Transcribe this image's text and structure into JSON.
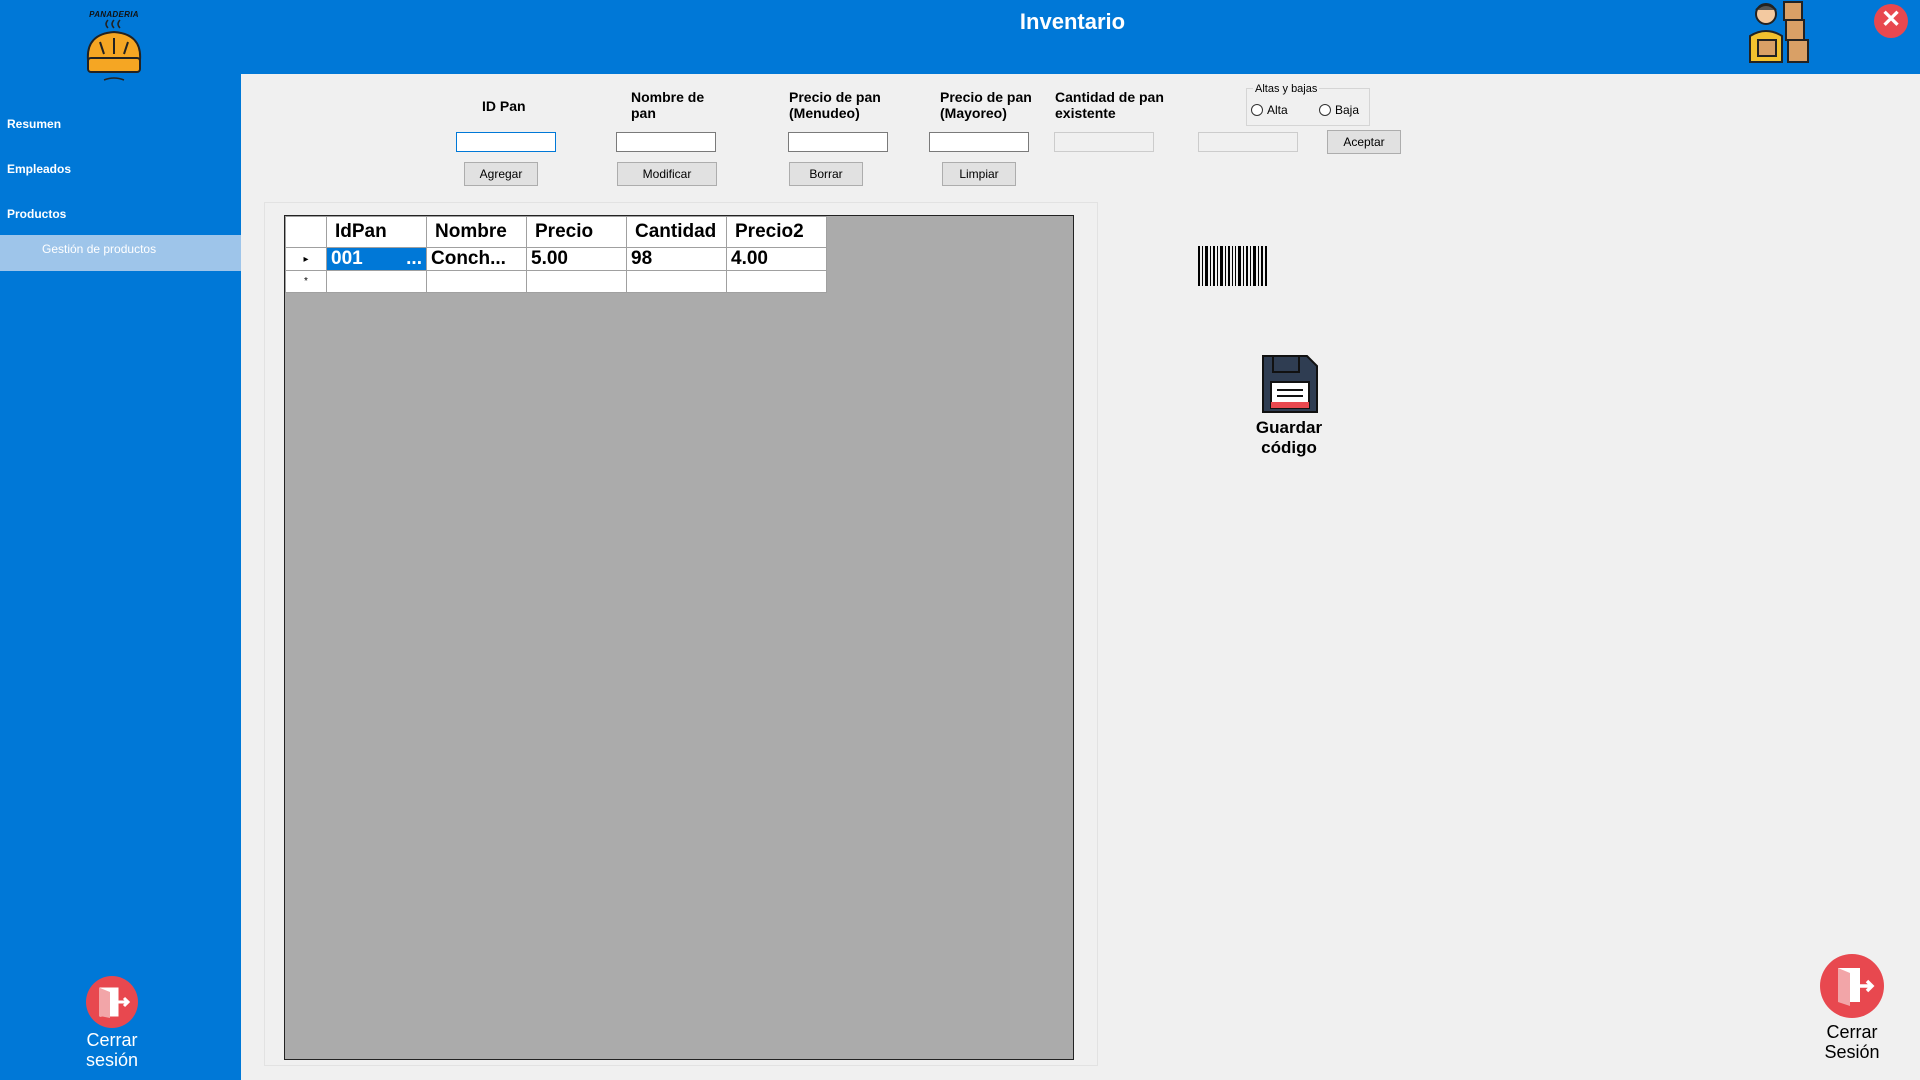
{
  "window": {
    "title": "Inventario",
    "close_glyph": "✕"
  },
  "logo": {
    "text": "PANADERIA"
  },
  "sidebar": {
    "items": [
      {
        "label": "Resumen"
      },
      {
        "label": "Empleados"
      },
      {
        "label": "Productos"
      }
    ],
    "subitem": {
      "label": "Gestión de productos"
    },
    "logout_label": "Cerrar sesión"
  },
  "form": {
    "labels": {
      "id_pan": "ID Pan",
      "nombre": "Nombre de pan",
      "precio_menudeo": "Precio de pan (Menudeo)",
      "precio_mayoreo": "Precio de pan (Mayoreo)",
      "cantidad": "Cantidad de pan existente"
    },
    "fields": {
      "id_pan": "",
      "nombre": "",
      "precio_menudeo": "",
      "precio_mayoreo": "",
      "cantidad": "",
      "ajuste": ""
    },
    "buttons": {
      "agregar": "Agregar",
      "modificar": "Modificar",
      "borrar": "Borrar",
      "limpiar": "Limpiar",
      "aceptar": "Aceptar"
    },
    "group": {
      "title": "Altas y bajas",
      "alta": "Alta",
      "baja": "Baja"
    }
  },
  "grid": {
    "columns": [
      "IdPan",
      "Nombre",
      "Precio",
      "Cantidad",
      "Precio2"
    ],
    "rows": [
      {
        "marker": "▸",
        "idpan": "001",
        "idpan_overflow": "...",
        "nombre": "Conch...",
        "precio": "5.00",
        "cantidad": "98",
        "precio2": "4.00"
      }
    ],
    "new_row_marker": "*"
  },
  "save": {
    "label": "Guardar código"
  },
  "main_logout": {
    "label_line1": "Cerrar",
    "label_line2": "Sesión"
  },
  "colors": {
    "primary": "#0078d7",
    "accent_red": "#e8484f",
    "selection": "#0078d7",
    "grid_bg": "#ababab",
    "subitem_bg": "#9ec5ea"
  }
}
